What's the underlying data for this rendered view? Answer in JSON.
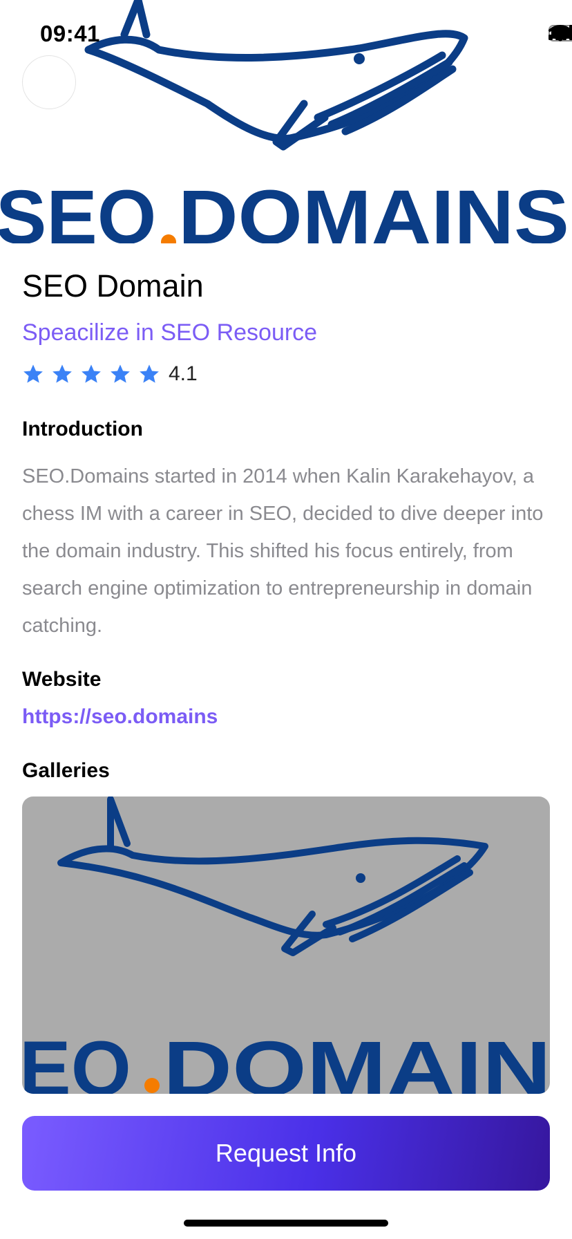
{
  "status_bar": {
    "time": "09:41"
  },
  "hero": {
    "logo_text_left": "SEO",
    "logo_text_right": "DOMAINS"
  },
  "detail": {
    "title": "SEO Domain",
    "subtitle": "Speacilize in SEO Resource",
    "rating": {
      "stars": 5,
      "value": "4.1"
    }
  },
  "introduction": {
    "label": "Introduction",
    "text": "SEO.Domains started in 2014 when Kalin Karakehayov, a chess  IM with a career in SEO, decided to dive deeper into the domain industry. This shifted his focus entirely, from search engine optimization to entrepreneurship in domain catching."
  },
  "website": {
    "label": "Website",
    "url": "https://seo.domains"
  },
  "galleries": {
    "label": "Galleries",
    "logo_text_left": "EO",
    "logo_text_right": "DOMAIN"
  },
  "actions": {
    "request_label": "Request Info"
  },
  "colors": {
    "accent": "#7b5cf5",
    "logo_blue": "#0b3d86",
    "logo_dot": "#f57c00",
    "star": "#3b82f6",
    "gallery_bg": "#ababab"
  }
}
